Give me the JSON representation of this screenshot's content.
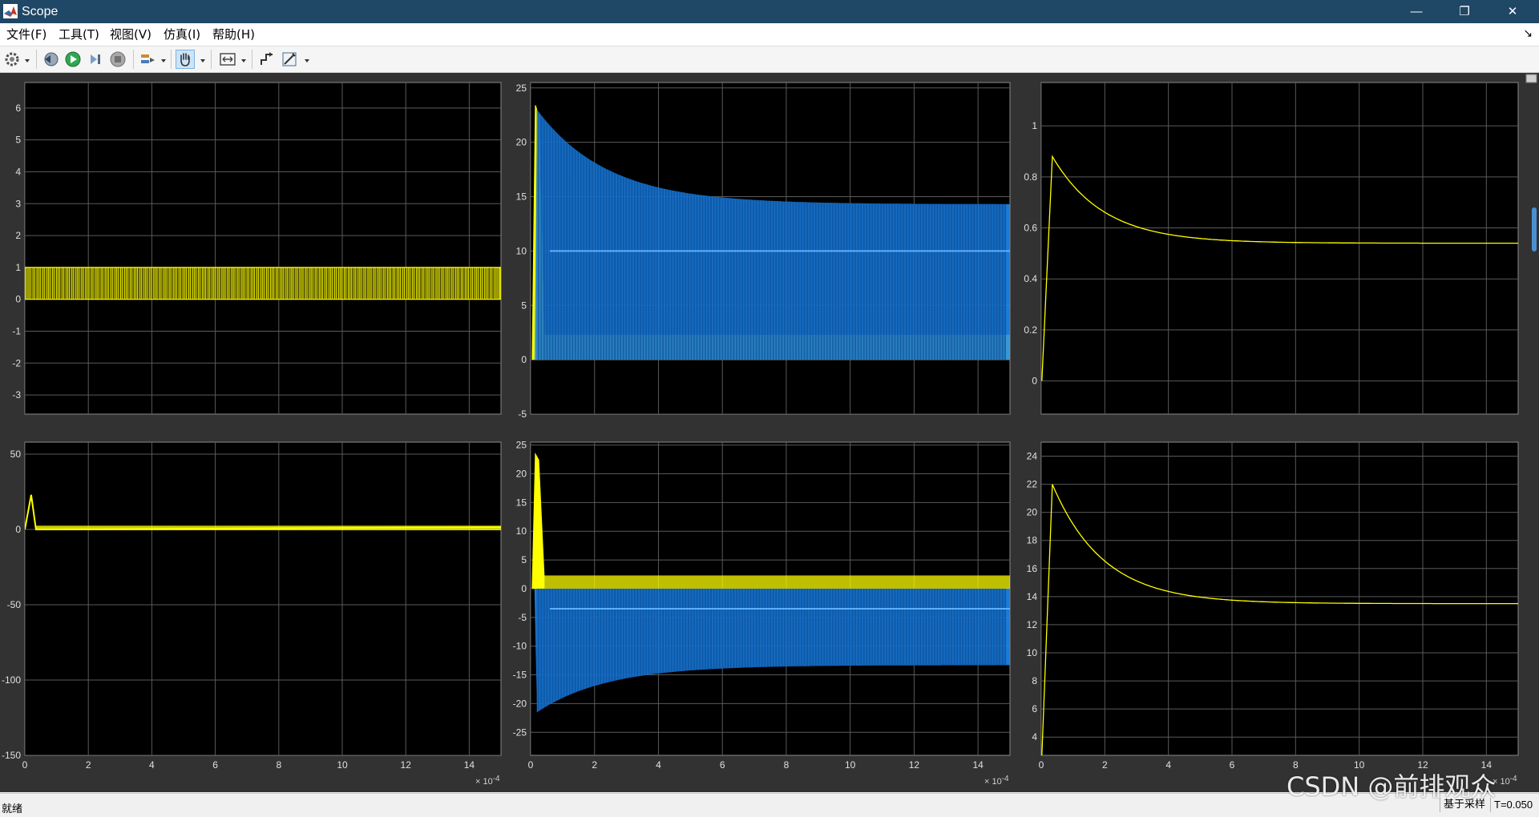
{
  "window": {
    "title": "Scope",
    "minimize_glyph": "—",
    "restore_glyph": "❐",
    "close_glyph": "✕"
  },
  "menu": {
    "items": [
      {
        "label": "文件(F)"
      },
      {
        "label": "工具(T)"
      },
      {
        "label": "视图(V)"
      },
      {
        "label": "仿真(I)"
      },
      {
        "label": "帮助(H)"
      }
    ],
    "dock_glyph": "↘"
  },
  "toolbar": {
    "icons": [
      "gear-icon",
      "step-back-icon",
      "run-icon",
      "step-forward-icon",
      "stop-icon",
      "signal-highlight-icon",
      "pan-hand-icon",
      "zoom-fit-icon",
      "trigger-icon",
      "measure-icon"
    ]
  },
  "colors": {
    "yellow_trace": "#ffff00",
    "blue_trace": "#1e90ff",
    "axes_bg": "#000000",
    "figure_bg": "#323232",
    "grid": "#5a5a5a",
    "title_bar": "#1f4766"
  },
  "chart_data": [
    {
      "id": "p11",
      "type": "line",
      "xlim": [
        0,
        15
      ],
      "ylim": [
        -3.6,
        6.8
      ],
      "xticks": [
        0,
        2,
        4,
        6,
        8,
        10,
        12,
        14
      ],
      "yticks": [
        -3,
        -2,
        -1,
        0,
        1,
        2,
        3,
        4,
        5,
        6
      ],
      "show_xticklabels": false,
      "series": [
        {
          "color": "yellow",
          "pattern": "pwm",
          "low": 0,
          "high": 1
        }
      ]
    },
    {
      "id": "p12",
      "type": "line",
      "xlim": [
        0,
        15
      ],
      "ylim": [
        -5,
        25.5
      ],
      "xticks": [
        0,
        2,
        4,
        6,
        8,
        10,
        12,
        14
      ],
      "yticks": [
        -5,
        0,
        5,
        10,
        15,
        20,
        25
      ],
      "show_xticklabels": false,
      "series": [
        {
          "color": "yellow",
          "pattern": "band",
          "low": 0,
          "high": 2.3,
          "peak": 23.4,
          "peak_t": 0.2
        },
        {
          "color": "blue",
          "pattern": "decay_band",
          "low": 0,
          "high_start": 23,
          "high_end": 14.3,
          "tau": 2.2,
          "mid": 10
        }
      ]
    },
    {
      "id": "p13",
      "type": "line",
      "xlim": [
        0,
        15
      ],
      "ylim": [
        -0.13,
        1.17
      ],
      "xticks": [
        0,
        2,
        4,
        6,
        8,
        10,
        12,
        14
      ],
      "yticks": [
        0,
        0.2,
        0.4,
        0.6,
        0.8,
        1
      ],
      "show_xticklabels": false,
      "series": [
        {
          "color": "yellow",
          "pattern": "step_overshoot",
          "start": 0,
          "peak": 0.88,
          "peak_t": 0.35,
          "final": 0.54,
          "tau": 1.6
        }
      ]
    },
    {
      "id": "p21",
      "type": "line",
      "xlim": [
        0,
        15
      ],
      "ylim": [
        -150,
        58
      ],
      "xticks": [
        0,
        2,
        4,
        6,
        8,
        10,
        12,
        14
      ],
      "yticks": [
        -150,
        -100,
        -50,
        0,
        50
      ],
      "show_xticklabels": true,
      "series": [
        {
          "color": "yellow",
          "pattern": "spike_flat",
          "peak": 23,
          "peak_t": 0.2,
          "final": 1.5
        }
      ]
    },
    {
      "id": "p22",
      "type": "line",
      "xlim": [
        0,
        15
      ],
      "ylim": [
        -29,
        25.5
      ],
      "xticks": [
        0,
        2,
        4,
        6,
        8,
        10,
        12,
        14
      ],
      "yticks": [
        -25,
        -20,
        -15,
        -10,
        -5,
        0,
        5,
        10,
        15,
        20,
        25
      ],
      "show_xticklabels": true,
      "series": [
        {
          "color": "yellow",
          "pattern": "band",
          "low": 0,
          "high": 2.3,
          "peak": 23.4,
          "peak_t": 0.2
        },
        {
          "color": "blue",
          "pattern": "decay_band",
          "low": 0,
          "high_start": -21.5,
          "high_end": -13.3,
          "tau": 2.2,
          "mid": -3.5
        }
      ]
    },
    {
      "id": "p23",
      "type": "line",
      "xlim": [
        0,
        15
      ],
      "ylim": [
        2.7,
        25
      ],
      "xticks": [
        0,
        2,
        4,
        6,
        8,
        10,
        12,
        14
      ],
      "yticks": [
        4,
        6,
        8,
        10,
        12,
        14,
        16,
        18,
        20,
        22,
        24
      ],
      "show_xticklabels": true,
      "series": [
        {
          "color": "yellow",
          "pattern": "step_overshoot",
          "start": 2.7,
          "peak": 22,
          "peak_t": 0.35,
          "final": 13.5,
          "tau": 1.6
        }
      ]
    }
  ],
  "axes": {
    "x_exponent_base": "× 10",
    "x_exponent_power": "-4"
  },
  "status": {
    "left": "就绪",
    "mode": "基于采样",
    "time": "T=0.050"
  },
  "watermark": "CSDN @前排观众"
}
